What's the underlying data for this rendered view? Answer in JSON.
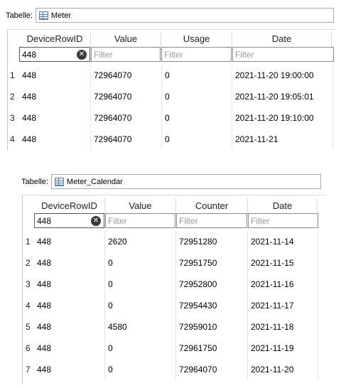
{
  "tables": [
    {
      "label": "Tabelle:",
      "table_name": "Meter",
      "columns": [
        "DeviceRowID",
        "Value",
        "Usage",
        "Date"
      ],
      "filters": [
        "448",
        "Filter",
        "Filter",
        "Filter"
      ],
      "rows": [
        {
          "num": "1",
          "cells": [
            "448",
            "72964070",
            "0",
            "2021-11-20 19:00:00"
          ]
        },
        {
          "num": "2",
          "cells": [
            "448",
            "72964070",
            "0",
            "2021-11-20 19:05:01"
          ]
        },
        {
          "num": "3",
          "cells": [
            "448",
            "72964070",
            "0",
            "2021-11-20 19:10:00"
          ]
        },
        {
          "num": "4",
          "cells": [
            "448",
            "72964070",
            "0",
            "2021-11-21"
          ]
        }
      ]
    },
    {
      "label": "Tabelle:",
      "table_name": "Meter_Calendar",
      "columns": [
        "DeviceRowID",
        "Value",
        "Counter",
        "Date"
      ],
      "filters": [
        "448",
        "Filter",
        "Filter",
        "Filter"
      ],
      "rows": [
        {
          "num": "1",
          "cells": [
            "448",
            "2620",
            "72951280",
            "2021-11-14"
          ]
        },
        {
          "num": "2",
          "cells": [
            "448",
            "0",
            "72951750",
            "2021-11-15"
          ]
        },
        {
          "num": "3",
          "cells": [
            "448",
            "0",
            "72952800",
            "2021-11-16"
          ]
        },
        {
          "num": "4",
          "cells": [
            "448",
            "0",
            "72954430",
            "2021-11-17"
          ]
        },
        {
          "num": "5",
          "cells": [
            "448",
            "4580",
            "72959010",
            "2021-11-18"
          ]
        },
        {
          "num": "6",
          "cells": [
            "448",
            "0",
            "72961750",
            "2021-11-19"
          ]
        },
        {
          "num": "7",
          "cells": [
            "448",
            "0",
            "72964070",
            "2021-11-20"
          ]
        }
      ]
    }
  ]
}
